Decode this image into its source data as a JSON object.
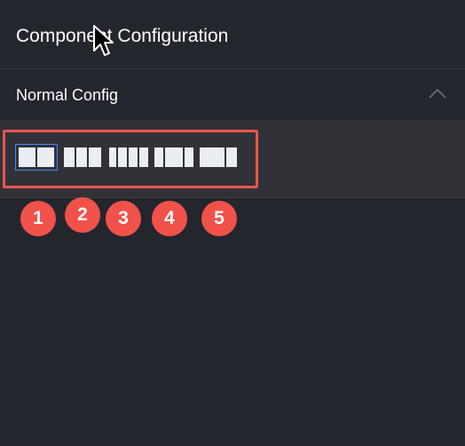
{
  "panel": {
    "title": "Component Configuration"
  },
  "section": {
    "title": "Normal Config",
    "collapse_icon": "chevron-up-icon"
  },
  "layout_options": [
    {
      "columns": "1:1",
      "selected": true
    },
    {
      "columns": "1:1:1",
      "selected": false
    },
    {
      "columns": "1:1:1:1",
      "selected": false
    },
    {
      "columns": "1:2:1",
      "selected": false
    },
    {
      "columns": "2:1",
      "selected": false
    }
  ],
  "badges": [
    "1",
    "2",
    "3",
    "4",
    "5"
  ],
  "colors": {
    "background": "#23262d",
    "section_body": "#303238",
    "highlight": "#e8554e",
    "selected_outline": "#4a82ff",
    "badge": "#f0524a"
  }
}
